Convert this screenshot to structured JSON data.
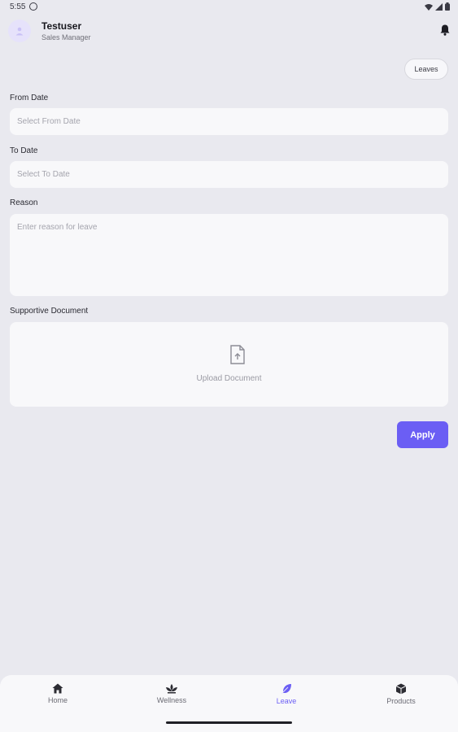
{
  "status_bar": {
    "time": "5:55",
    "icons": [
      "dnd-icon",
      "wifi-icon",
      "signal-icon",
      "battery-icon"
    ]
  },
  "header": {
    "user_name": "Testuser",
    "user_role": "Sales Manager",
    "icons": [
      "avatar-icon",
      "bell-icon"
    ]
  },
  "leaves_button": {
    "label": "Leaves"
  },
  "form": {
    "from_date": {
      "label": "From Date",
      "placeholder": "Select From Date"
    },
    "to_date": {
      "label": "To Date",
      "placeholder": "Select To Date"
    },
    "reason": {
      "label": "Reason",
      "placeholder": "Enter reason for leave"
    },
    "document": {
      "label": "Supportive Document",
      "upload_text": "Upload Document",
      "icon": "file-upload-icon"
    },
    "apply_label": "Apply"
  },
  "bottom_nav": {
    "items": [
      {
        "label": "Home",
        "icon": "home-icon"
      },
      {
        "label": "Wellness",
        "icon": "lotus-icon"
      },
      {
        "label": "Leave",
        "icon": "feather-icon",
        "active": true
      },
      {
        "label": "Products",
        "icon": "box-icon"
      }
    ]
  },
  "colors": {
    "accent": "#6b5ef4",
    "background": "#e9e9ef",
    "field": "#f8f8fa"
  }
}
